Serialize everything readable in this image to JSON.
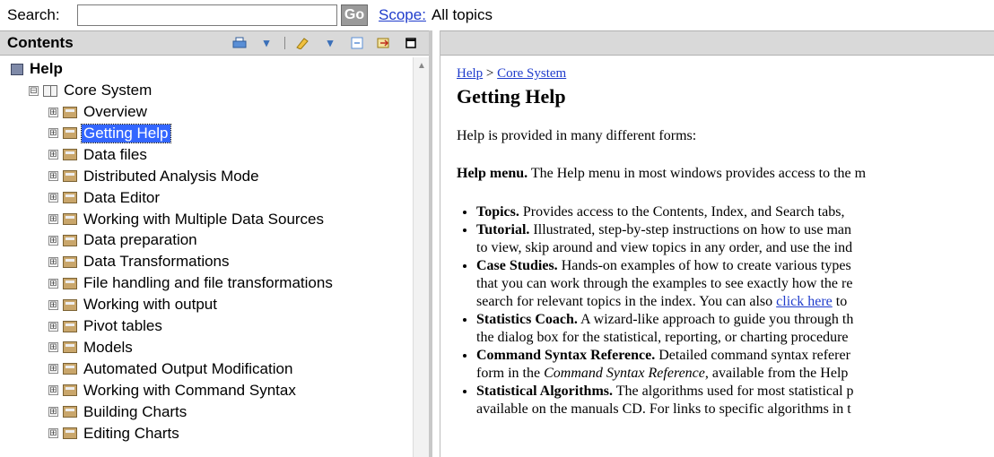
{
  "search": {
    "label": "Search:",
    "value": "",
    "go_label": "Go",
    "scope_label": "Scope:",
    "scope_value": "All topics"
  },
  "contents": {
    "title": "Contents",
    "root": "Help",
    "section": "Core System",
    "items": [
      "Overview",
      "Getting Help",
      "Data files",
      "Distributed Analysis Mode",
      "Data Editor",
      "Working with Multiple Data Sources",
      "Data preparation",
      "Data Transformations",
      "File handling and file transformations",
      "Working with output",
      "Pivot tables",
      "Models",
      "Automated Output Modification",
      "Working with Command Syntax",
      "Building Charts",
      "Editing Charts"
    ],
    "selected_index": 1,
    "expand_symbol": "⊞",
    "collapse_symbol": "⊟"
  },
  "article": {
    "breadcrumb": {
      "home": "Help",
      "sep": " > ",
      "section": "Core System"
    },
    "title": "Getting Help",
    "intro": "Help is provided in many different forms:",
    "help_menu_bold": "Help menu.",
    "help_menu_text": " The Help menu in most windows provides access to the m",
    "bullets": [
      {
        "bold": "Topics.",
        "lines": [
          " Provides access to the Contents, Index, and Search tabs, "
        ]
      },
      {
        "bold": "Tutorial.",
        "lines": [
          " Illustrated, step-by-step instructions on how to use man",
          "to view, skip around and view topics in any order, and use the ind"
        ]
      },
      {
        "bold": "Case Studies.",
        "lines": [
          " Hands-on examples of how to create various types",
          "that you can work through the examples to see exactly how the re"
        ],
        "line3_pre": "search for relevant topics in the index. You can also ",
        "line3_link": "click here",
        "line3_post": " to"
      },
      {
        "bold": "Statistics Coach.",
        "lines": [
          " A wizard-like approach to guide you through th",
          "the dialog box for the statistical, reporting, or charting procedure"
        ]
      },
      {
        "bold": "Command Syntax Reference.",
        "lines": [
          " Detailed command syntax referer"
        ],
        "line2_pre": "form in the ",
        "line2_italic": "Command Syntax Reference",
        "line2_post": ", available from the Help"
      },
      {
        "bold": "Statistical Algorithms.",
        "lines": [
          " The algorithms used for most statistical p",
          "available on the manuals CD. For links to specific algorithms in t"
        ]
      }
    ]
  },
  "colors": {
    "selected_bg": "#3366ff",
    "link": "#1f3ccc",
    "header_bg": "#d9d9d9"
  }
}
